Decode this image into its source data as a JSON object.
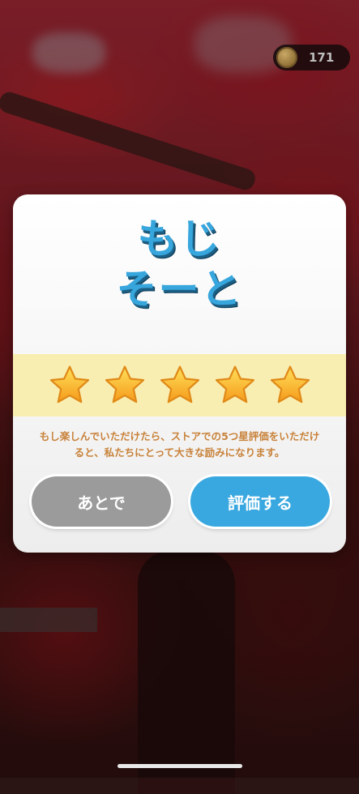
{
  "coins": {
    "count": "171"
  },
  "dialog": {
    "title_line1": "もじ",
    "title_line2": "そーと",
    "rating_stars": 5,
    "message": "もし楽しんでいただけたら、ストアでの5つ星評価をいただけると、私たちにとって大きな励みになります。",
    "later_button": "あとで",
    "rate_button": "評価する"
  },
  "colors": {
    "title": "#37a6dd",
    "rate_button": "#3aa8e0",
    "later_button": "#9b9b9b",
    "star_band": "#f9eeb1",
    "message": "#c8823a"
  }
}
